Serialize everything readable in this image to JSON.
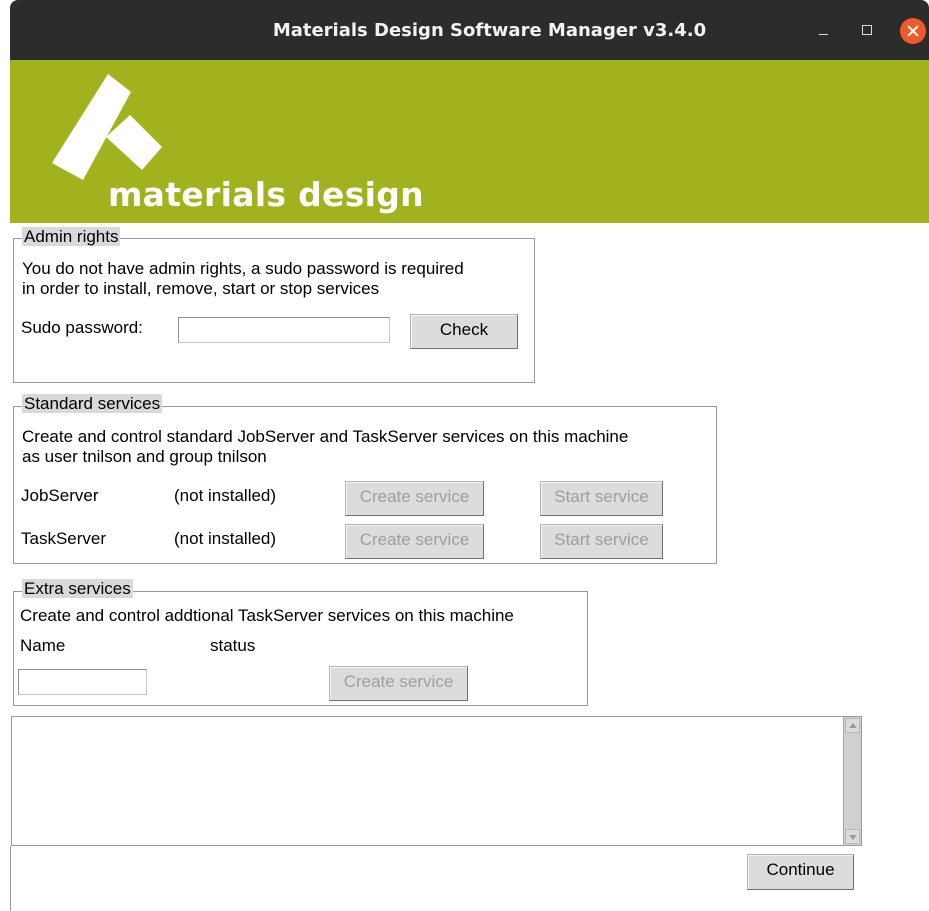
{
  "window": {
    "title": "Materials Design Software Manager v3.4.0",
    "controls": [
      "minimize-icon",
      "maximize-icon",
      "close-icon"
    ]
  },
  "banner": {
    "wordmark": "materials design",
    "background_color": "#a2b21f"
  },
  "admin": {
    "legend": "Admin rights",
    "message_line1": "You do not have admin rights, a sudo password is required",
    "message_line2": "in order to install, remove, start or stop services",
    "password_label": "Sudo password:",
    "password_value": "",
    "check_label": "Check"
  },
  "standard": {
    "legend": "Standard services",
    "description_line1": "Create and control standard JobServer and TaskServer services on this machine",
    "description_line2": "as user tnilson and group tnilson",
    "services": [
      {
        "name": "JobServer",
        "status": "(not installed)",
        "create_label": "Create service",
        "start_label": "Start service"
      },
      {
        "name": "TaskServer",
        "status": "(not installed)",
        "create_label": "Create service",
        "start_label": "Start service"
      }
    ]
  },
  "extra": {
    "legend": "Extra services",
    "description": "Create and control addtional TaskServer services on this machine",
    "name_header": "Name",
    "status_header": "status",
    "name_value": "",
    "create_label": "Create service"
  },
  "log": {
    "text": ""
  },
  "footer": {
    "continue_label": "Continue"
  }
}
